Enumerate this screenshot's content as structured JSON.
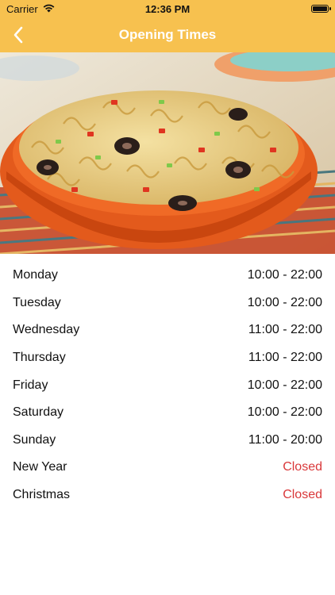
{
  "status_bar": {
    "carrier": "Carrier",
    "time": "12:36 PM"
  },
  "nav": {
    "title": "Opening Times",
    "back_icon": "chevron-left-icon"
  },
  "colors": {
    "header": "#f7c14f",
    "closed": "#d9383a"
  },
  "hours": [
    {
      "day": "Monday",
      "time": "10:00 - 22:00",
      "closed": false
    },
    {
      "day": "Tuesday",
      "time": "10:00 - 22:00",
      "closed": false
    },
    {
      "day": "Wednesday",
      "time": "11:00 - 22:00",
      "closed": false
    },
    {
      "day": "Thursday",
      "time": "11:00 - 22:00",
      "closed": false
    },
    {
      "day": "Friday",
      "time": "10:00 - 22:00",
      "closed": false
    },
    {
      "day": "Saturday",
      "time": "10:00 - 22:00",
      "closed": false
    },
    {
      "day": "Sunday",
      "time": "11:00 - 20:00",
      "closed": false
    },
    {
      "day": "New Year",
      "time": "Closed",
      "closed": true
    },
    {
      "day": "Christmas",
      "time": "Closed",
      "closed": true
    }
  ]
}
